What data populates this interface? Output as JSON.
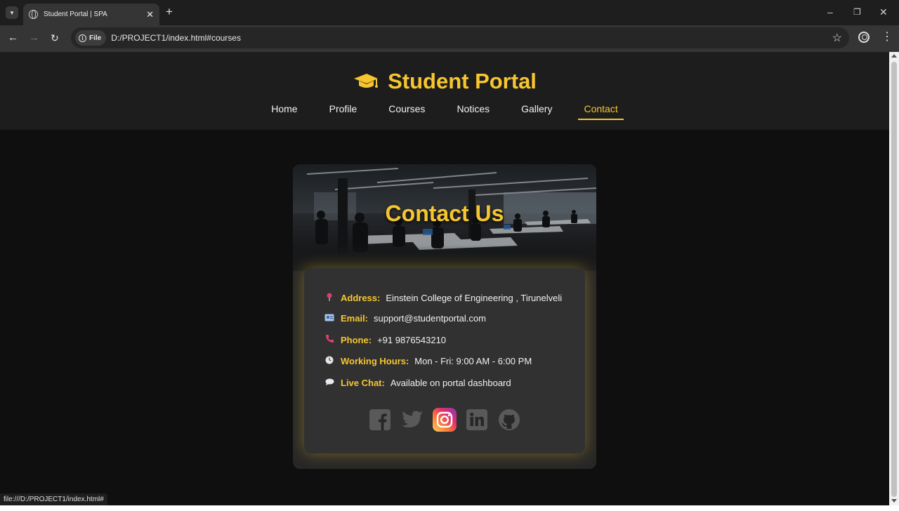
{
  "browser": {
    "tab_title": "Student Portal | SPA",
    "tab_close": "✕",
    "new_tab": "+",
    "security_chip": "File",
    "url": "D:/PROJECT1/index.html#courses",
    "status_url": "file:///D:/PROJECT1/index.html#",
    "icons": [
      "tab-search-icon",
      "globe-icon",
      "back-arrow-icon",
      "forward-arrow-icon",
      "reload-icon",
      "info-icon",
      "star-icon",
      "profile-icon",
      "kebab-menu-icon",
      "minimize-icon",
      "restore-icon",
      "close-window-icon"
    ]
  },
  "site": {
    "title": "Student Portal",
    "logo_icon": "graduation-cap-icon",
    "nav": [
      {
        "label": "Home",
        "active": false
      },
      {
        "label": "Profile",
        "active": false
      },
      {
        "label": "Courses",
        "active": false
      },
      {
        "label": "Notices",
        "active": false
      },
      {
        "label": "Gallery",
        "active": false
      },
      {
        "label": "Contact",
        "active": true
      }
    ],
    "accent_color": "#f7c62f"
  },
  "contact": {
    "heading": "Contact Us",
    "rows": [
      {
        "icon": "pin-icon",
        "label": "Address:",
        "value": "Einstein College of Engineering , Tirunelveli"
      },
      {
        "icon": "id-card-icon",
        "label": "Email:",
        "value": "support@studentportal.com"
      },
      {
        "icon": "phone-icon",
        "label": "Phone:",
        "value": "+91 9876543210"
      },
      {
        "icon": "clock-icon",
        "label": "Working Hours:",
        "value": "Mon - Fri: 9:00 AM - 6:00 PM"
      },
      {
        "icon": "chat-bubble-icon",
        "label": "Live Chat:",
        "value": "Available on portal dashboard"
      }
    ],
    "socials": [
      "facebook-icon",
      "twitter-icon",
      "instagram-icon",
      "linkedin-icon",
      "github-icon"
    ],
    "highlighted_social": "instagram-icon"
  }
}
